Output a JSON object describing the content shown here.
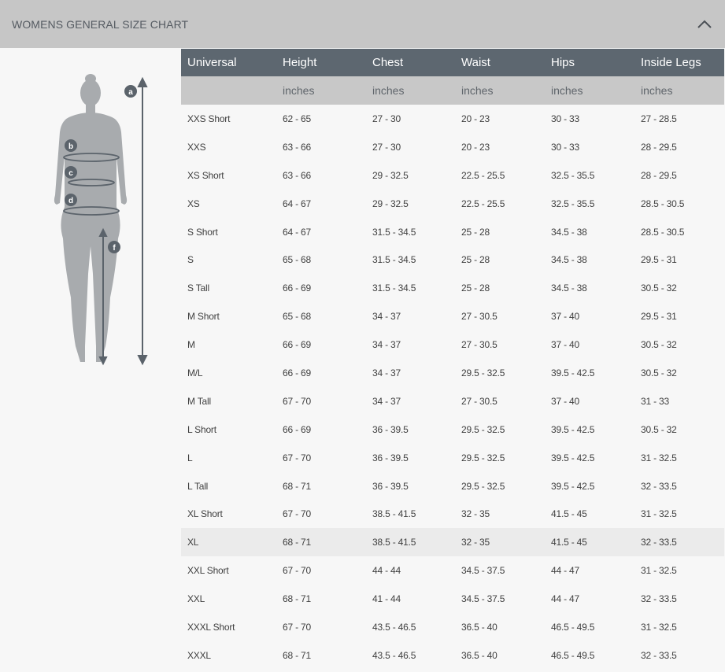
{
  "accordion": {
    "title": "WOMENS GENERAL SIZE CHART",
    "state": "expanded",
    "toggle_icon": "chevron-up-icon"
  },
  "figure": {
    "markers": [
      "a",
      "b",
      "c",
      "d",
      "f"
    ]
  },
  "table": {
    "columns": [
      "Universal",
      "Height",
      "Chest",
      "Waist",
      "Hips",
      "Inside Legs"
    ],
    "units": [
      "",
      "inches",
      "inches",
      "inches",
      "inches",
      "inches"
    ],
    "highlighted_row": "XL",
    "rows": [
      [
        "XXS Short",
        "62 - 65",
        "27 - 30",
        "20 - 23",
        "30 - 33",
        "27 - 28.5"
      ],
      [
        "XXS",
        "63 - 66",
        "27 - 30",
        "20 - 23",
        "30 - 33",
        "28 - 29.5"
      ],
      [
        "XS Short",
        "63 - 66",
        "29 - 32.5",
        "22.5 - 25.5",
        "32.5 - 35.5",
        "28 - 29.5"
      ],
      [
        "XS",
        "64 - 67",
        "29 - 32.5",
        "22.5 - 25.5",
        "32.5 - 35.5",
        "28.5 - 30.5"
      ],
      [
        "S Short",
        "64 - 67",
        "31.5 - 34.5",
        "25 - 28",
        "34.5 - 38",
        "28.5 - 30.5"
      ],
      [
        "S",
        "65 - 68",
        "31.5 - 34.5",
        "25 - 28",
        "34.5 - 38",
        "29.5 - 31"
      ],
      [
        "S Tall",
        "66 - 69",
        "31.5 - 34.5",
        "25 - 28",
        "34.5 - 38",
        "30.5 - 32"
      ],
      [
        "M Short",
        "65 - 68",
        "34 - 37",
        "27 - 30.5",
        "37 - 40",
        "29.5 - 31"
      ],
      [
        "M",
        "66 - 69",
        "34 - 37",
        "27 - 30.5",
        "37 - 40",
        "30.5 - 32"
      ],
      [
        "M/L",
        "66 - 69",
        "34 - 37",
        "29.5 - 32.5",
        "39.5 - 42.5",
        "30.5 - 32"
      ],
      [
        "M Tall",
        "67 - 70",
        "34 - 37",
        "27 - 30.5",
        "37 - 40",
        "31 - 33"
      ],
      [
        "L Short",
        "66 - 69",
        "36 - 39.5",
        "29.5 - 32.5",
        "39.5 - 42.5",
        "30.5 - 32"
      ],
      [
        "L",
        "67 - 70",
        "36 - 39.5",
        "29.5 - 32.5",
        "39.5 - 42.5",
        "31 - 32.5"
      ],
      [
        "L Tall",
        "68 - 71",
        "36 - 39.5",
        "29.5 - 32.5",
        "39.5 - 42.5",
        "32 - 33.5"
      ],
      [
        "XL Short",
        "67 - 70",
        "38.5 - 41.5",
        "32 - 35",
        "41.5 - 45",
        "31 - 32.5"
      ],
      [
        "XL",
        "68 - 71",
        "38.5 - 41.5",
        "32 - 35",
        "41.5 - 45",
        "32 - 33.5"
      ],
      [
        "XXL Short",
        "67 - 70",
        "44 - 44",
        "34.5 - 37.5",
        "44 - 47",
        "31 - 32.5"
      ],
      [
        "XXL",
        "68 - 71",
        "41 - 44",
        "34.5 - 37.5",
        "44 - 47",
        "32 - 33.5"
      ],
      [
        "XXXL Short",
        "67 - 70",
        "43.5 - 46.5",
        "36.5 - 40",
        "46.5 - 49.5",
        "31 - 32.5"
      ],
      [
        "XXXL",
        "68 - 71",
        "43.5 - 46.5",
        "36.5 - 40",
        "46.5 - 49.5",
        "32 - 33.5"
      ]
    ]
  },
  "colors": {
    "header_bar": "#c6c6c6",
    "table_header": "#5d6770",
    "unit_row": "#c8c8c8",
    "highlight_row": "#ebebeb",
    "figure": "#a8abae",
    "marker": "#5b636b"
  }
}
